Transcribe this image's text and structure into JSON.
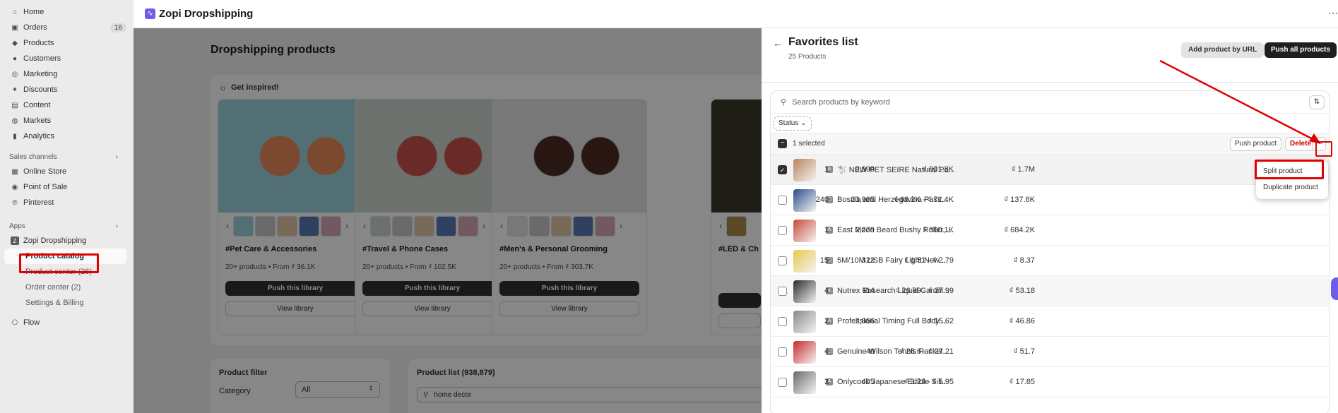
{
  "sidebar": {
    "nav": [
      {
        "label": "Home",
        "icon": "home-icon",
        "glyph": "⌂"
      },
      {
        "label": "Orders",
        "icon": "inbox-icon",
        "glyph": "▣",
        "badge": "16"
      },
      {
        "label": "Products",
        "icon": "tag-icon",
        "glyph": "◆"
      },
      {
        "label": "Customers",
        "icon": "person-icon",
        "glyph": "●"
      },
      {
        "label": "Marketing",
        "icon": "target-icon",
        "glyph": "◎"
      },
      {
        "label": "Discounts",
        "icon": "discount-icon",
        "glyph": "✦"
      },
      {
        "label": "Content",
        "icon": "content-icon",
        "glyph": "▤"
      },
      {
        "label": "Markets",
        "icon": "globe-icon",
        "glyph": "◍"
      },
      {
        "label": "Analytics",
        "icon": "bar-chart-icon",
        "glyph": "▮"
      }
    ],
    "sales_channels_label": "Sales channels",
    "channels": [
      {
        "label": "Online Store",
        "icon": "store-icon",
        "glyph": "▦"
      },
      {
        "label": "Point of Sale",
        "icon": "pos-icon",
        "glyph": "◉"
      },
      {
        "label": "Pinterest",
        "icon": "pinterest-icon",
        "glyph": "℗"
      }
    ],
    "apps_label": "Apps",
    "app_name": "Zopi Dropshipping",
    "app_sub": [
      "Product catalog",
      "Product center (26)",
      "Order center (2)",
      "Settings & Billing"
    ],
    "flow_label": "Flow"
  },
  "topbar": {
    "title": "Zopi Dropshipping"
  },
  "main": {
    "title": "Dropshipping products",
    "inspire_label": "Get inspired!",
    "cards": [
      {
        "title": "#Pet Care & Accessories",
        "sub": "20+ products • From ₫ 36.1K",
        "img": "#9ad2dc",
        "accent": "#e88a5a"
      },
      {
        "title": "#Travel & Phone Cases",
        "sub": "20+ products • From ₫ 102.5K",
        "img": "#cfd6cf",
        "accent": "#c9504a"
      },
      {
        "title": "#Men's & Personal Grooming",
        "sub": "20+ products • From ₫ 303.7K",
        "img": "#e2e2e2",
        "accent": "#4a2a22"
      }
    ],
    "card4_title": "#LED & Ch",
    "push_label": "Push this library",
    "view_label": "View library",
    "filter_title": "Product filter",
    "category_label": "Category",
    "category_value": "All",
    "plist_title": "Product list (938,879)",
    "plist_search": "home decor"
  },
  "panel": {
    "title": "Favorites list",
    "subtitle": "25 Products",
    "add_url_label": "Add product by URL",
    "push_all_label": "Push all products",
    "search_placeholder": "Search products by keyword",
    "status_label": "Status",
    "selected_label": "1 selected",
    "push_product_label": "Push product",
    "delete_label": "Delete",
    "more_label": "···",
    "menu": [
      "Split product",
      "Duplicate product"
    ],
    "rows": [
      {
        "name": "🐩 NEW PET SEIRE Natural Pa...",
        "v1": "1",
        "v2": "9,999",
        "v3": "₫ 901.8K",
        "v4": "₫ 1.7M",
        "img": "#b9835a",
        "src": "A",
        "checked": true
      },
      {
        "name": "Bosnia and Herzegovina Pass...",
        "v1": "240",
        "v2": "23,965",
        "v3": "₫ 68.2K - ₫ 72.4K",
        "v4": "₫ 137.6K",
        "img": "#2a4a8a",
        "src": "▢",
        "checked": false
      },
      {
        "name": "East Moon Beard Bushy Roller,...",
        "v1": "1",
        "v2": "2,279",
        "v3": "₫ 360.1K",
        "v4": "₫ 684.2K",
        "img": "#c84a3a",
        "src": "A",
        "checked": false
      },
      {
        "name": "5M/10M USB Fairy Light New ...",
        "v1": "15",
        "v2": "322",
        "v3": "₫ 1.51 - ₫ 2.79",
        "v4": "₫ 8.37",
        "img": "#e8c84a",
        "src": "▢",
        "checked": false
      },
      {
        "name": "Nutrex Research Liquid Carniti...",
        "v1": "4",
        "v2": "114",
        "v3": "₫ 26.99 - ₫ 27.99",
        "v4": "₫ 53.18",
        "img": "#2a2a2a",
        "src": "a",
        "checked": false
      },
      {
        "name": "Professional Timing Full Body ...",
        "v1": "2",
        "v2": "2,866",
        "v3": "₫ 15.62",
        "v4": "₫ 46.86",
        "img": "#8a8a8a",
        "src": "A",
        "checked": false
      },
      {
        "name": "Genuine Wilson Tennis Racket...",
        "v1": "4",
        "v2": "40",
        "v3": "₫ 26.6 - ₫ 27.21",
        "v4": "₫ 51.7",
        "img": "#c8282a",
        "src": "▢",
        "checked": false
      },
      {
        "name": "Onlycook Japanese Edible Sili...",
        "v1": "3",
        "v2": "405",
        "v3": "₫ 3.23 - ₫ 5.95",
        "v4": "₫ 17.85",
        "img": "#6a6a6a",
        "src": "A",
        "checked": false
      }
    ]
  },
  "colors": {
    "annotation_red": "#e00000",
    "brand": "#6f5ce8"
  }
}
